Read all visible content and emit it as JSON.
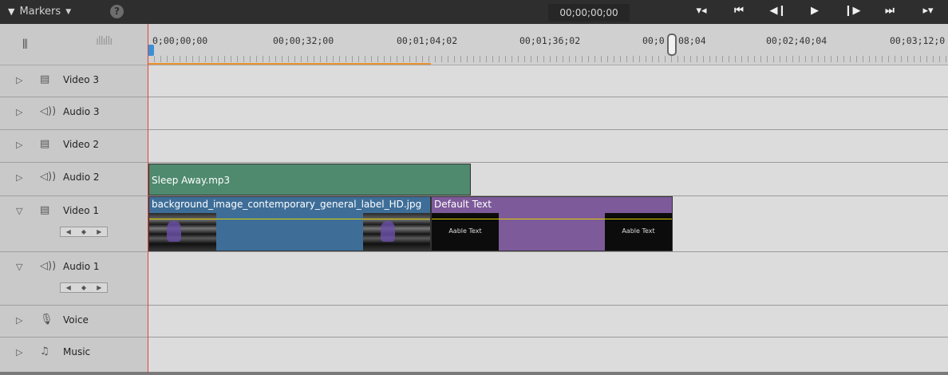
{
  "header": {
    "markers_label": "Markers",
    "help_label": "?",
    "timecode": "00;00;00;00",
    "transport": [
      {
        "icon": "go-to-start-marker-icon",
        "glyph": "▾◂"
      },
      {
        "icon": "skip-back-icon",
        "glyph": "⏮"
      },
      {
        "icon": "step-back-icon",
        "glyph": "◀❙"
      },
      {
        "icon": "play-icon",
        "glyph": "▶"
      },
      {
        "icon": "step-forward-icon",
        "glyph": "❙▶"
      },
      {
        "icon": "skip-forward-icon",
        "glyph": "⏭"
      },
      {
        "icon": "go-to-end-marker-icon",
        "glyph": "▸▾"
      }
    ]
  },
  "ruler": {
    "labels": [
      "0;00;00;00",
      "00;00;32;00",
      "00;01;04;02",
      "00;01;36;02",
      "00;0",
      "08;04",
      "00;02;40;04",
      "00;03;12;0"
    ]
  },
  "tracks": [
    {
      "name": "Video 3",
      "kind": "video",
      "expanded": false
    },
    {
      "name": "Audio 3",
      "kind": "audio",
      "expanded": false
    },
    {
      "name": "Video 2",
      "kind": "video",
      "expanded": false
    },
    {
      "name": "Audio 2",
      "kind": "audio",
      "expanded": false
    },
    {
      "name": "Video 1",
      "kind": "video",
      "expanded": true
    },
    {
      "name": "Audio 1",
      "kind": "audio",
      "expanded": true
    },
    {
      "name": "Voice",
      "kind": "voice",
      "expanded": false
    },
    {
      "name": "Music",
      "kind": "music",
      "expanded": false
    }
  ],
  "clips": {
    "audio2": "Sleep Away.mp3",
    "video1_image": "background_image_contemporary_general_label_HD.jpg",
    "video1_title": "Default Text",
    "title_thumb_text": "Aable Text"
  },
  "colors": {
    "audio_clip": "#4f8a6e",
    "image_clip": "#3e6e98",
    "title_clip": "#7d5a9a",
    "playhead": "#e04444",
    "work_area": "#e8922c"
  }
}
